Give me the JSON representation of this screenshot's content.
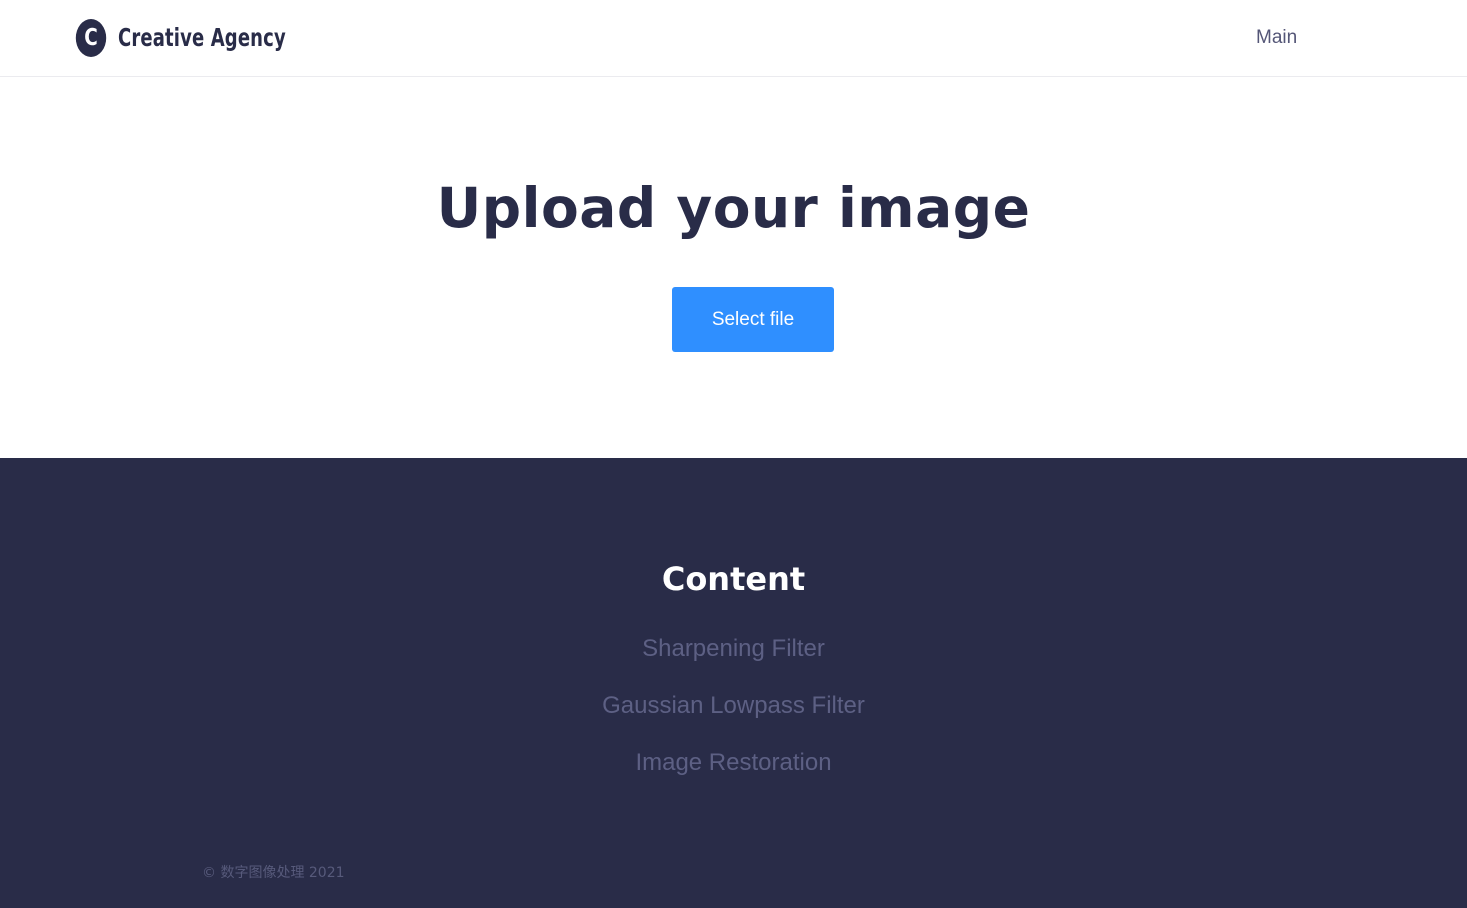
{
  "header": {
    "logo_letter": "C",
    "brand_name": "Creative Agency",
    "nav": {
      "main_label": "Main"
    }
  },
  "hero": {
    "title": "Upload your image",
    "select_file_label": "Select file"
  },
  "footer": {
    "title": "Content",
    "links": [
      "Sharpening Filter",
      "Gaussian Lowpass Filter",
      "Image Restoration"
    ],
    "copyright": "© 数字图像处理 2021"
  },
  "colors": {
    "primary_dark": "#292c48",
    "accent_blue": "#2f8fff",
    "footer_link": "#5d6084",
    "nav_text": "#545677"
  }
}
